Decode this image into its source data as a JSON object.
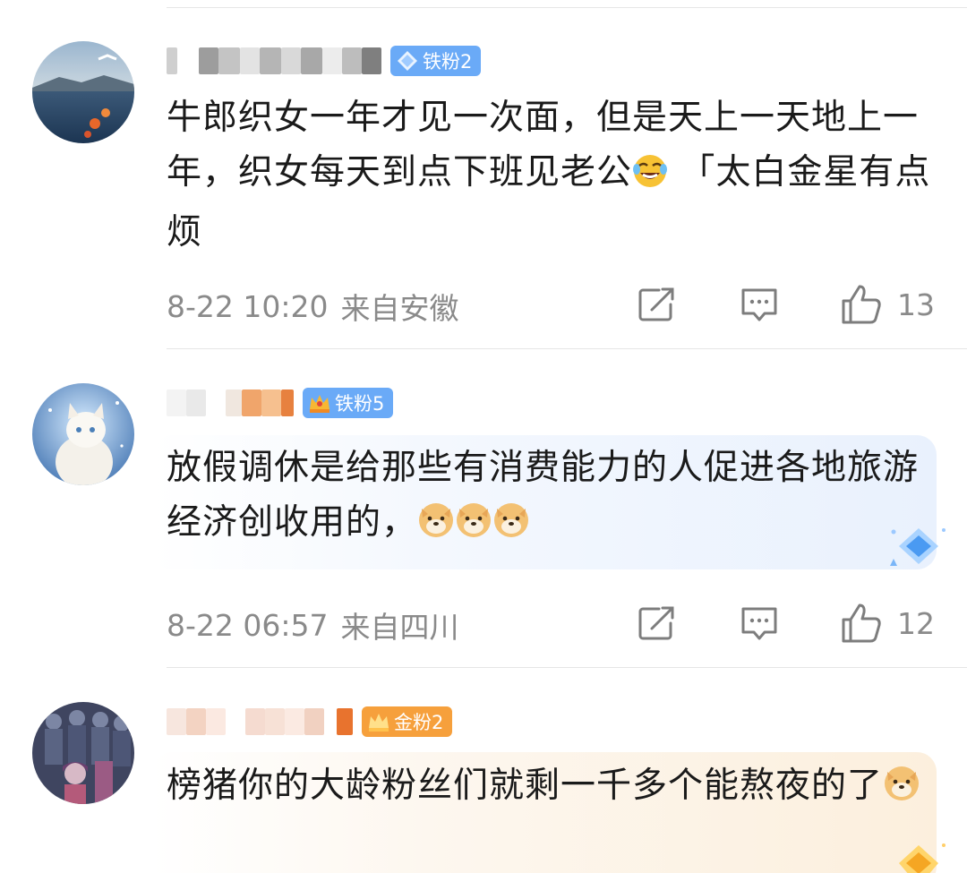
{
  "comments": [
    {
      "badge": "铁粉2",
      "text": "牛郎织女一年才见一次面，但是天上一天地上一年，织女每天到点下班见老公",
      "text_tail": " 「太白金星有点烦",
      "time": "8-22 10:20",
      "location": "来自安徽",
      "likes": "13",
      "badge_color": "#5fa3f5"
    },
    {
      "badge": "铁粉5",
      "text": "放假调休是给那些有消费能力的人促进各地旅游经济创收用的，",
      "time": "8-22 06:57",
      "location": "来自四川",
      "likes": "12",
      "badge_color": "#5fa3f5"
    },
    {
      "badge": "金粉2",
      "text": "榜猪你的大龄粉丝们就剩一千多个能熬夜的了",
      "badge_color": "#f6a03c"
    }
  ],
  "icons": {
    "share": "share-icon",
    "comment": "comment-icon",
    "like": "thumbs-up-icon",
    "laugh_emoji": "laughing-tears-emoji",
    "doge_emoji": "doge-emoji"
  }
}
